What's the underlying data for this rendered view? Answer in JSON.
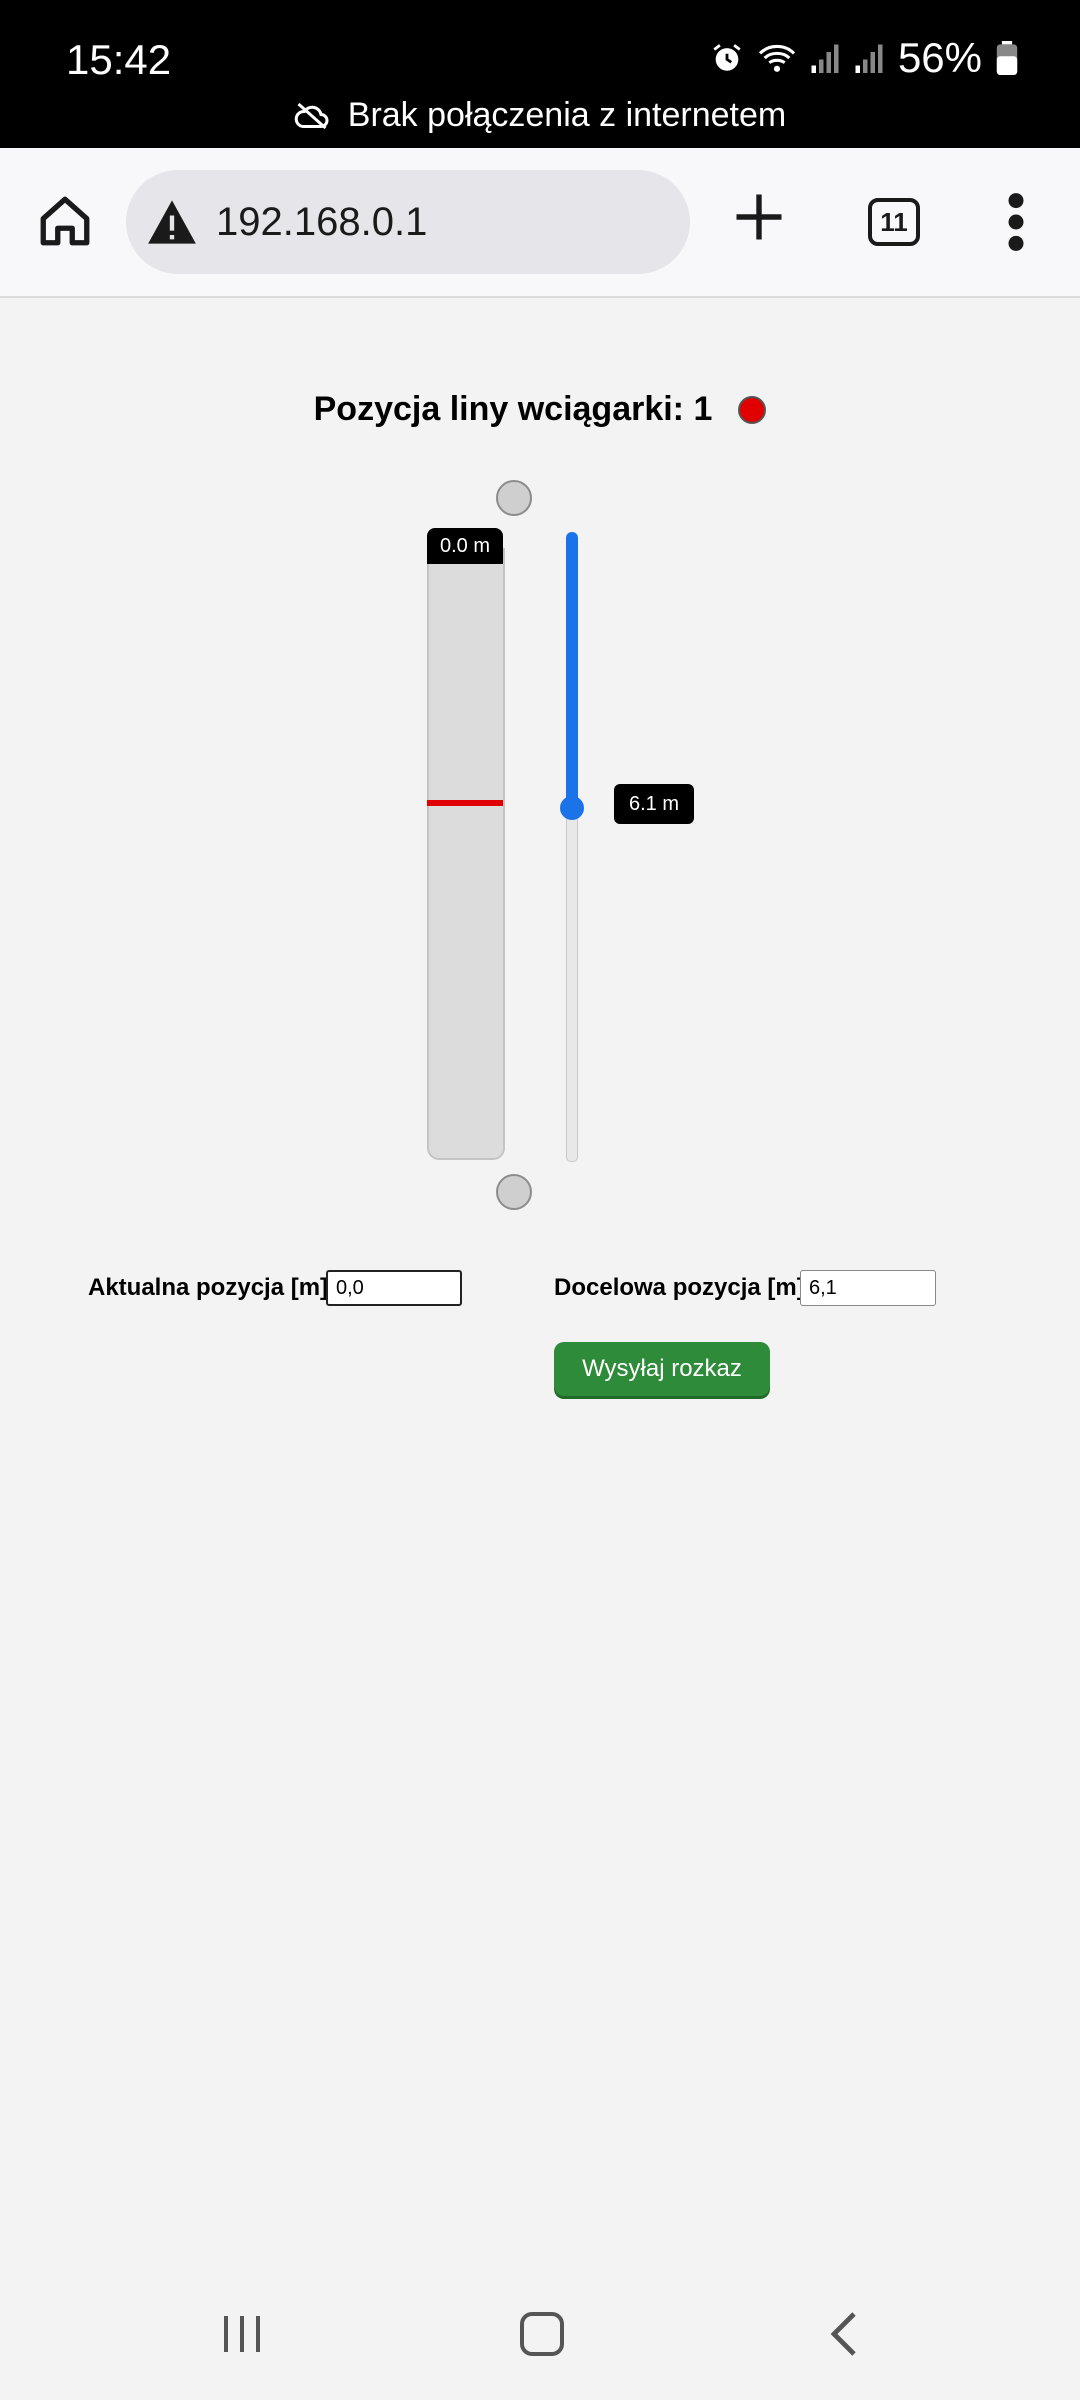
{
  "status_bar": {
    "time": "15:42",
    "battery": "56%",
    "icons": [
      "alarm-icon",
      "wifi-icon",
      "signal-icon",
      "signal-icon",
      "battery-icon"
    ],
    "offline_text": "Brak połączenia z internetem"
  },
  "browser": {
    "url": "192.168.0.1",
    "tab_count": "11"
  },
  "page": {
    "title": "Pozycja liny wciągarki: 1",
    "status_color": "#e00000",
    "gauge": {
      "top_label": "0.0 m",
      "current_position_fraction": 0.42
    },
    "slider": {
      "value_label": "6.1 m",
      "fill_fraction": 0.44
    },
    "current_position": {
      "label": "Aktualna pozycja [m]:",
      "value": "0,0"
    },
    "target_position": {
      "label": "Docelowa pozycja [m]:",
      "value": "6,1"
    },
    "send_button": "Wysyłaj rozkaz"
  },
  "colors": {
    "accent": "#1a73e8",
    "button": "#2e8b3a",
    "marker": "#e00000"
  }
}
